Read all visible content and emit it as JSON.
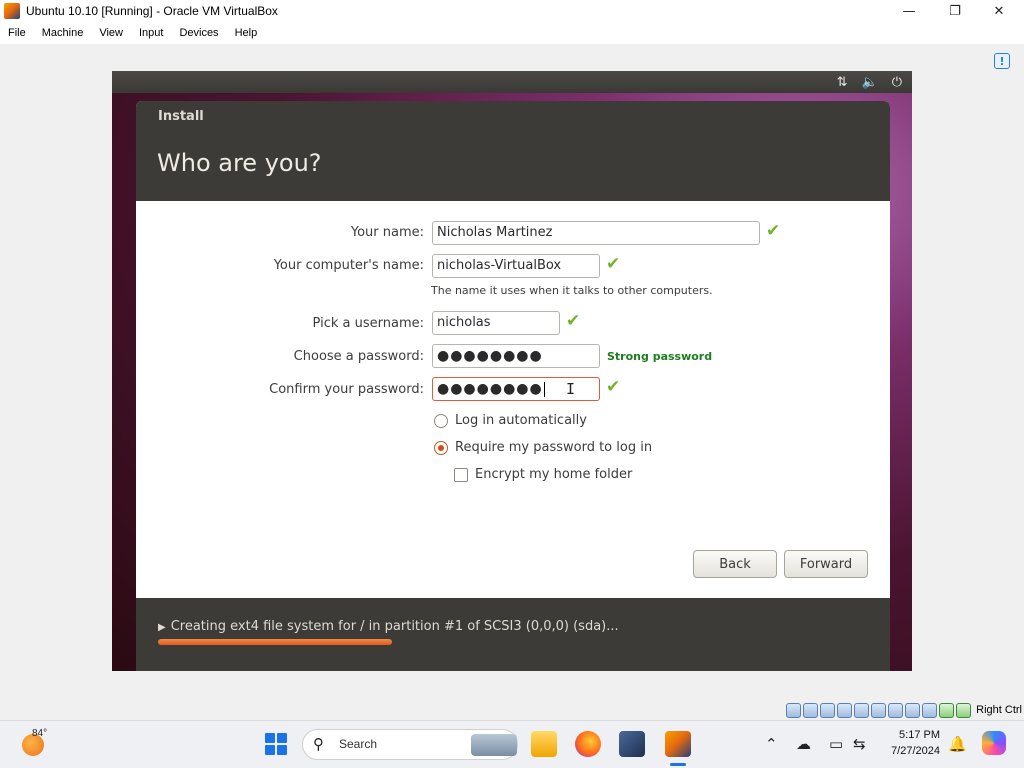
{
  "window": {
    "title": "Ubuntu 10.10 [Running] - Oracle VM VirtualBox",
    "minimize": "—",
    "maximize": "❐",
    "close": "✕"
  },
  "menu": [
    "File",
    "Machine",
    "View",
    "Input",
    "Devices",
    "Help"
  ],
  "vm": {
    "tray": {
      "network": "⇅",
      "volume": "🔈",
      "power": "⏻"
    },
    "installer": {
      "window_label": "Install",
      "title": "Who are you?",
      "fields": {
        "name": {
          "label": "Your name:",
          "value": "Nicholas Martinez"
        },
        "computer": {
          "label": "Your computer's name:",
          "value": "nicholas-VirtualBox",
          "hint": "The name it uses when it talks to other computers."
        },
        "username": {
          "label": "Pick a username:",
          "value": "nicholas"
        },
        "password": {
          "label": "Choose a password:",
          "value": "●●●●●●●●",
          "strength": "Strong password"
        },
        "confirm": {
          "label": "Confirm your password:",
          "value": "●●●●●●●●"
        }
      },
      "check_glyph": "✔",
      "ibeam_glyph": "I",
      "options": {
        "login_auto": "Log in automatically",
        "require_password": "Require my password to log in",
        "encrypt_home": "Encrypt my home folder"
      },
      "selected_option": "require_password",
      "encrypt_checked": false,
      "buttons": {
        "back": "Back",
        "forward": "Forward"
      },
      "status": {
        "triangle": "▶",
        "text": "Creating ext4 file system for / in partition #1 of SCSI3 (0,0,0) (sda)...",
        "progress": 0.33
      }
    }
  },
  "vbox_status": {
    "host_key": "Right Ctrl"
  },
  "taskbar": {
    "weather": "84°",
    "search": {
      "icon": "⚲",
      "text": "Search"
    },
    "tray": {
      "chevron": "⌃",
      "cloud": "☁",
      "display": "▭",
      "network": "⇆"
    },
    "clock": {
      "time": "5:17 PM",
      "date": "7/27/2024"
    },
    "bell": "🔔",
    "colors": {
      "accent": "#1a73e8",
      "ubuntu_orange": "#dd4814",
      "check_green": "#73b32b"
    }
  }
}
